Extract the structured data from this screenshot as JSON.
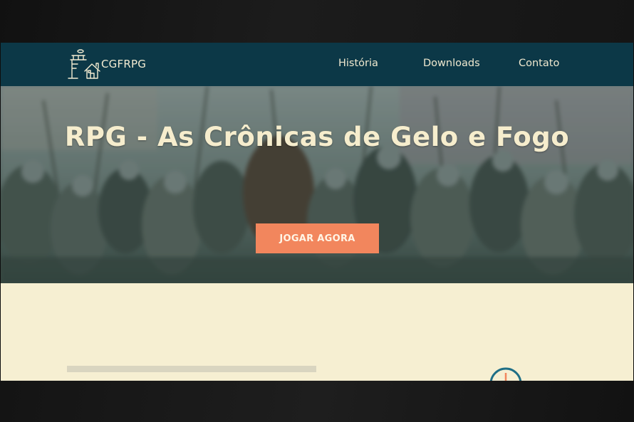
{
  "brand": {
    "name": "CGFRPG",
    "logo": "castle-logo-icon"
  },
  "nav": {
    "items": [
      {
        "label": "História"
      },
      {
        "label": "Downloads"
      },
      {
        "label": "Contato"
      }
    ]
  },
  "hero": {
    "title": "RPG - As Crônicas de Gelo e Fogo",
    "cta_label": "JOGAR AGORA"
  },
  "colors": {
    "navbar": "#0c3847",
    "accent": "#f2865d",
    "page_background": "#f6efd2",
    "title_text": "#f6edcd"
  }
}
